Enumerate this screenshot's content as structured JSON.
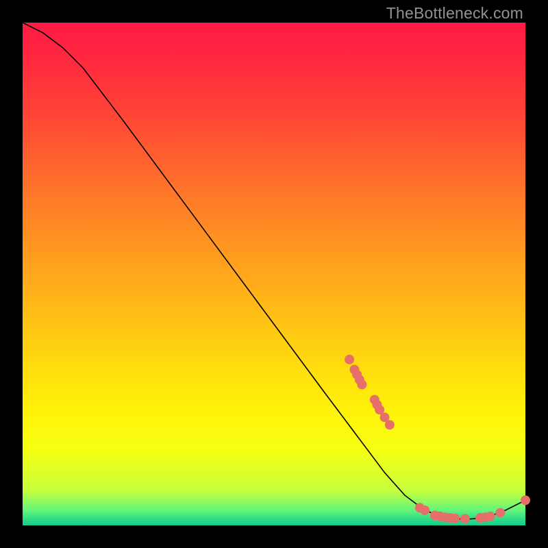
{
  "watermark": "TheBottleneck.com",
  "chart_data": {
    "type": "line",
    "title": "",
    "xlabel": "",
    "ylabel": "",
    "xlim": [
      0,
      100
    ],
    "ylim": [
      0,
      100
    ],
    "curve": [
      {
        "x": 0,
        "y": 100
      },
      {
        "x": 4,
        "y": 98
      },
      {
        "x": 8,
        "y": 95
      },
      {
        "x": 12,
        "y": 91
      },
      {
        "x": 20,
        "y": 80.5
      },
      {
        "x": 30,
        "y": 67
      },
      {
        "x": 40,
        "y": 53.5
      },
      {
        "x": 50,
        "y": 40
      },
      {
        "x": 60,
        "y": 26.5
      },
      {
        "x": 66,
        "y": 18.5
      },
      {
        "x": 72,
        "y": 10.5
      },
      {
        "x": 76,
        "y": 6
      },
      {
        "x": 80,
        "y": 3
      },
      {
        "x": 84,
        "y": 1.5
      },
      {
        "x": 88,
        "y": 1.2
      },
      {
        "x": 92,
        "y": 1.5
      },
      {
        "x": 96,
        "y": 3
      },
      {
        "x": 100,
        "y": 5
      }
    ],
    "markers": [
      {
        "x": 65,
        "y": 33
      },
      {
        "x": 66,
        "y": 31
      },
      {
        "x": 66.5,
        "y": 30
      },
      {
        "x": 67,
        "y": 29
      },
      {
        "x": 67.5,
        "y": 28
      },
      {
        "x": 70,
        "y": 25
      },
      {
        "x": 70.5,
        "y": 24
      },
      {
        "x": 71,
        "y": 23
      },
      {
        "x": 72,
        "y": 21.5
      },
      {
        "x": 73,
        "y": 20
      },
      {
        "x": 79,
        "y": 3.5
      },
      {
        "x": 80,
        "y": 3
      },
      {
        "x": 82,
        "y": 2
      },
      {
        "x": 83,
        "y": 1.8
      },
      {
        "x": 84,
        "y": 1.6
      },
      {
        "x": 85,
        "y": 1.5
      },
      {
        "x": 86,
        "y": 1.4
      },
      {
        "x": 88,
        "y": 1.3
      },
      {
        "x": 91,
        "y": 1.5
      },
      {
        "x": 92,
        "y": 1.6
      },
      {
        "x": 93,
        "y": 1.8
      },
      {
        "x": 95,
        "y": 2.5
      },
      {
        "x": 100,
        "y": 5
      }
    ],
    "curve_color": "#000000",
    "curve_width": 1.6,
    "marker_color": "#e76f6a",
    "marker_radius": 7
  }
}
